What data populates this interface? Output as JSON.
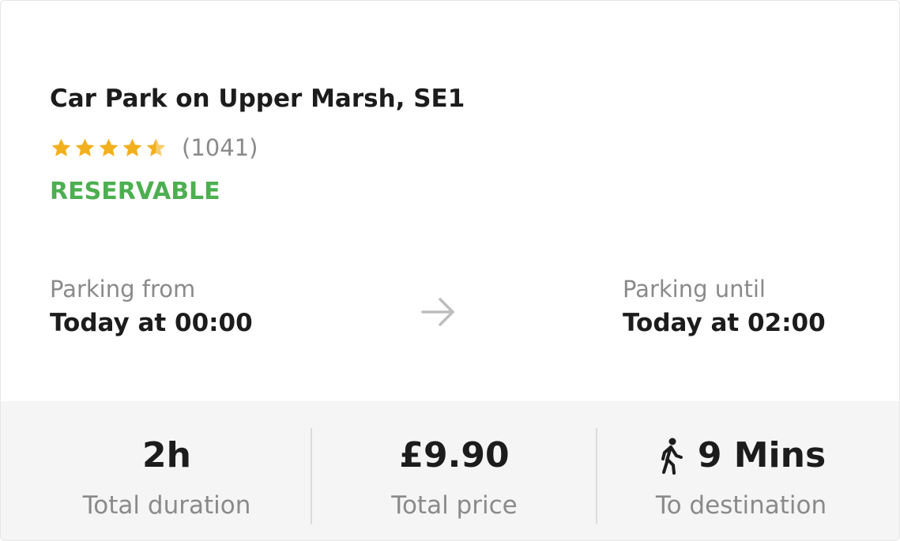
{
  "listing": {
    "title": "Car Park on Upper Marsh, SE1",
    "rating": 4.5,
    "rating_max": 5,
    "rating_count": "(1041)",
    "status": "RESERVABLE"
  },
  "parking": {
    "from_label": "Parking from",
    "from_value": "Today at 00:00",
    "until_label": "Parking until",
    "until_value": "Today at 02:00"
  },
  "summary": {
    "duration_value": "2h",
    "duration_label": "Total duration",
    "price_value": "£9.90",
    "price_label": "Total price",
    "walk_value": "9 Mins",
    "walk_label": "To destination"
  },
  "icons": {
    "star": "star-icon",
    "arrow": "arrow-right-icon",
    "walk": "walking-person-icon"
  },
  "colors": {
    "star": "#f2b01e",
    "status": "#4caf50",
    "muted_text": "#8a8a8a",
    "footer_bg": "#f5f5f5"
  }
}
